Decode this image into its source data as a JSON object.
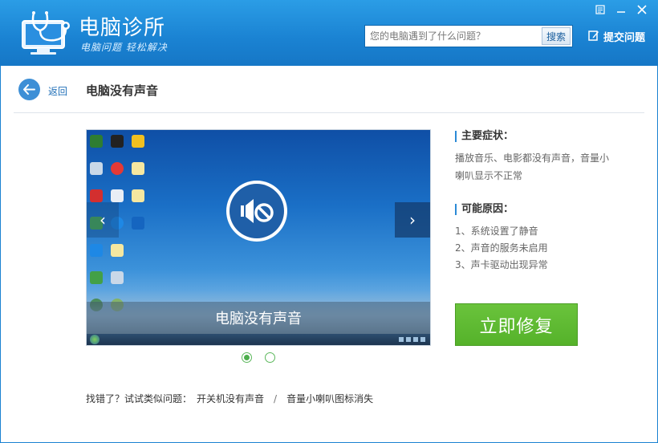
{
  "app": {
    "title": "电脑诊所",
    "subtitle": "电脑问题 轻松解决"
  },
  "window_controls": {
    "menu_icon": "menu-icon",
    "minimize_icon": "minimize-icon",
    "close_icon": "close-icon"
  },
  "search": {
    "placeholder": "您的电脑遇到了什么问题？",
    "button_label": "搜索"
  },
  "header": {
    "submit_label": "提交问题"
  },
  "nav": {
    "back_label": "返回",
    "page_title": "电脑没有声音"
  },
  "carousel": {
    "caption": "电脑没有声音",
    "prev_glyph": "‹",
    "next_glyph": "›",
    "slide_count": 2,
    "active_slide": 1
  },
  "symptoms": {
    "heading": "主要症状：",
    "text": "播放音乐、电影都没有声音，音量小喇叭显示不正常"
  },
  "causes": {
    "heading": "可能原因：",
    "items": [
      "1、系统设置了静音",
      "2、声音的服务未启用",
      "3、声卡驱动出现异常"
    ]
  },
  "actions": {
    "fix_label": "立即修复"
  },
  "related": {
    "prefix": "找错了？试试类似问题：",
    "links": [
      "开关机没有声音",
      "音量小喇叭图标消失"
    ],
    "separator": "/"
  },
  "colors": {
    "header_blue": "#1a82d2",
    "accent_green": "#55b22a",
    "link_blue": "#2170b8"
  }
}
